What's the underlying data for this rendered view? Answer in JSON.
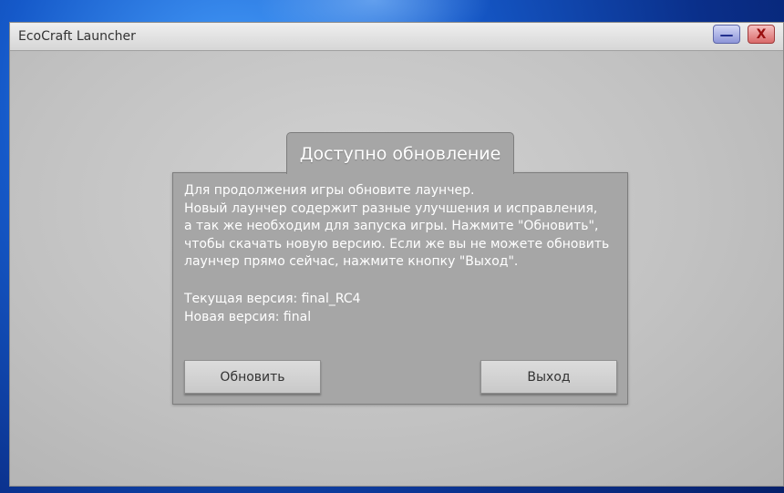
{
  "window": {
    "title": "EcoCraft Launcher",
    "minimize_label": "—",
    "close_label": "X"
  },
  "dialog": {
    "title": "Доступно обновление",
    "message_lines": [
      "Для продолжения игры обновите лаунчер.",
      "Новый лаунчер содержит разные улучшения и исправления,",
      "а так же необходим для запуска игры. Нажмите \"Обновить\",",
      "чтобы скачать новую версию. Если же вы не можете обновить",
      "лаунчер прямо сейчас, нажмите кнопку \"Выход\"."
    ],
    "current_version": "Текущая версия: final_RC4",
    "new_version": "Новая версия: final",
    "update_button": "Обновить",
    "exit_button": "Выход"
  },
  "colors": {
    "minimize_button": "#8d95d8",
    "close_button": "#d96a6a",
    "dialog_background": "#a6a6a6",
    "window_background": "#cdcdcd"
  }
}
